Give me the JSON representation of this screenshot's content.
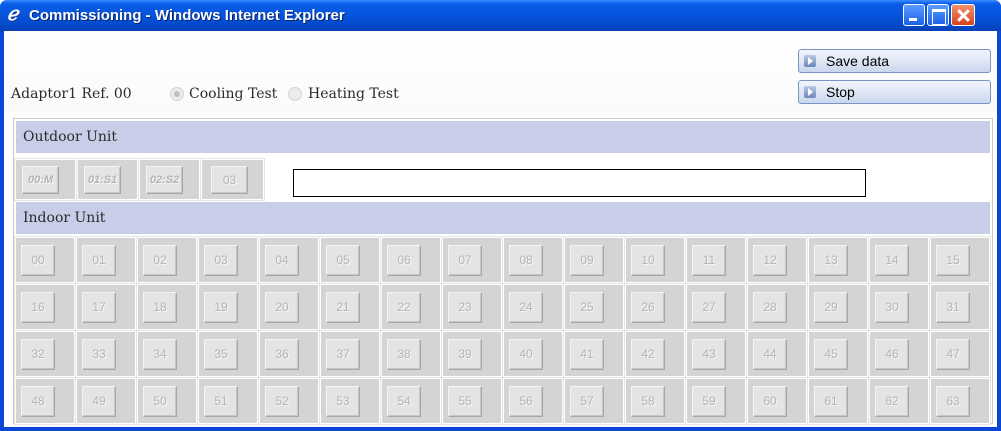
{
  "window": {
    "title": "Commissioning - Windows Internet Explorer"
  },
  "toolbar": {
    "adaptor_label": "Adaptor1  Ref. 00",
    "cooling_label": "Cooling Test",
    "heating_label": "Heating Test",
    "save_label": "Save data",
    "stop_label": "Stop"
  },
  "outdoor": {
    "header": "Outdoor Unit",
    "units": [
      "00:M",
      "01:S1",
      "02:S2",
      "03"
    ],
    "status_value": ""
  },
  "indoor": {
    "header": "Indoor Unit",
    "units": [
      "00",
      "01",
      "02",
      "03",
      "04",
      "05",
      "06",
      "07",
      "08",
      "09",
      "10",
      "11",
      "12",
      "13",
      "14",
      "15",
      "16",
      "17",
      "18",
      "19",
      "20",
      "21",
      "22",
      "23",
      "24",
      "25",
      "26",
      "27",
      "28",
      "29",
      "30",
      "31",
      "32",
      "33",
      "34",
      "35",
      "36",
      "37",
      "38",
      "39",
      "40",
      "41",
      "42",
      "43",
      "44",
      "45",
      "46",
      "47",
      "48",
      "49",
      "50",
      "51",
      "52",
      "53",
      "54",
      "55",
      "56",
      "57",
      "58",
      "59",
      "60",
      "61",
      "62",
      "63"
    ]
  }
}
